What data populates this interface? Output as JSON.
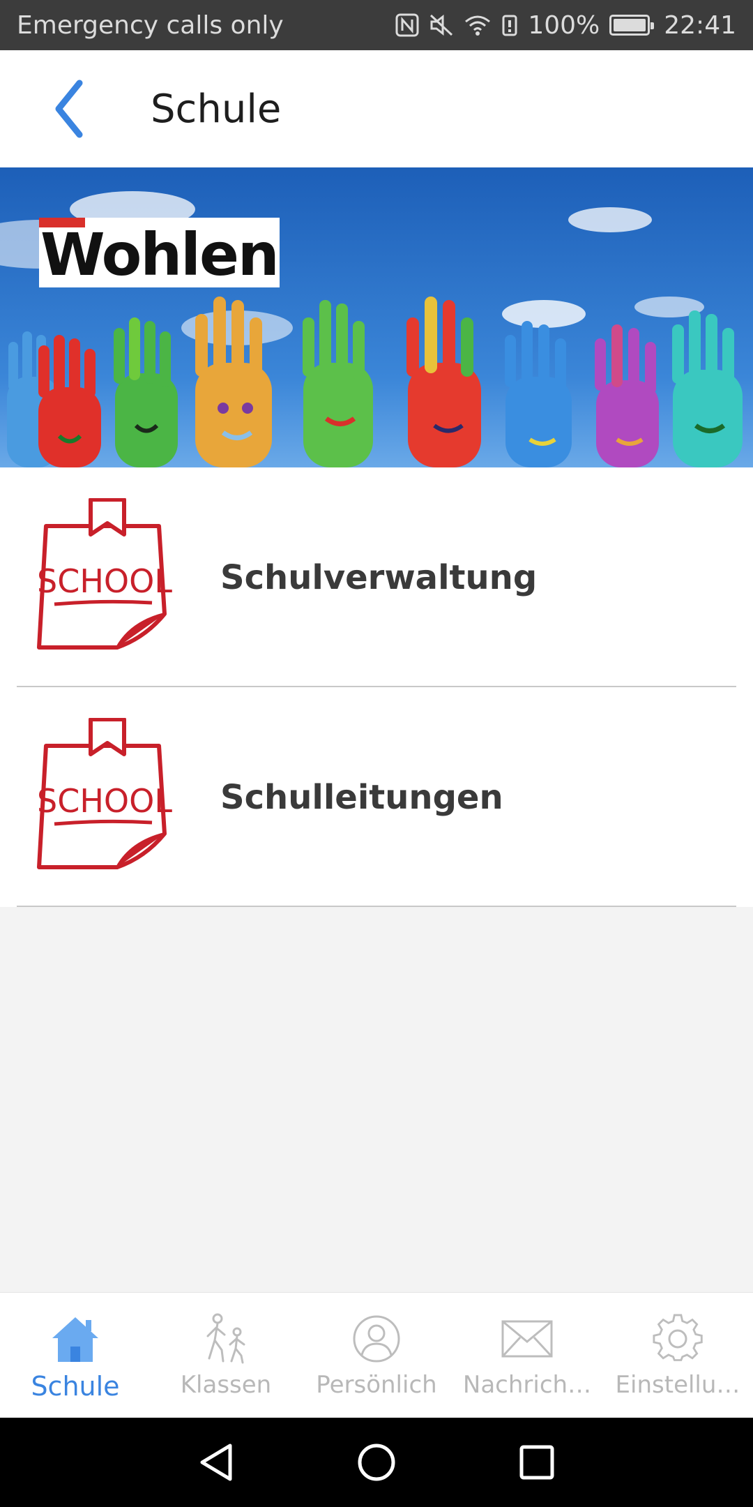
{
  "status_bar": {
    "carrier": "Emergency calls only",
    "battery": "100%",
    "battery_level": 1.0,
    "time": "22:41",
    "icons": [
      "nfc-icon",
      "mute-icon",
      "wifi-icon",
      "battery-saver-icon",
      "battery-icon"
    ]
  },
  "header": {
    "title": "Schule",
    "back_icon": "chevron-left-icon"
  },
  "banner": {
    "logo_text": "Wohlen"
  },
  "list": {
    "items": [
      {
        "label": "Schulverwaltung",
        "icon": "school-note-icon",
        "icon_text": "SCHOOL"
      },
      {
        "label": "Schulleitungen",
        "icon": "school-note-icon",
        "icon_text": "SCHOOL"
      }
    ]
  },
  "tabs": [
    {
      "label": "Schule",
      "icon": "home-icon",
      "active": true
    },
    {
      "label": "Klassen",
      "icon": "walking-people-icon",
      "active": false
    },
    {
      "label": "Persönlich",
      "icon": "person-icon",
      "active": false
    },
    {
      "label": "Nachrich…",
      "icon": "envelope-icon",
      "active": false
    },
    {
      "label": "Einstellu…",
      "icon": "gear-icon",
      "active": false
    }
  ],
  "colors": {
    "accent": "#3a84e0",
    "status_bar": "#3c3c3c",
    "school_red": "#c8202a",
    "inactive_tab": "#b8b8b8"
  }
}
